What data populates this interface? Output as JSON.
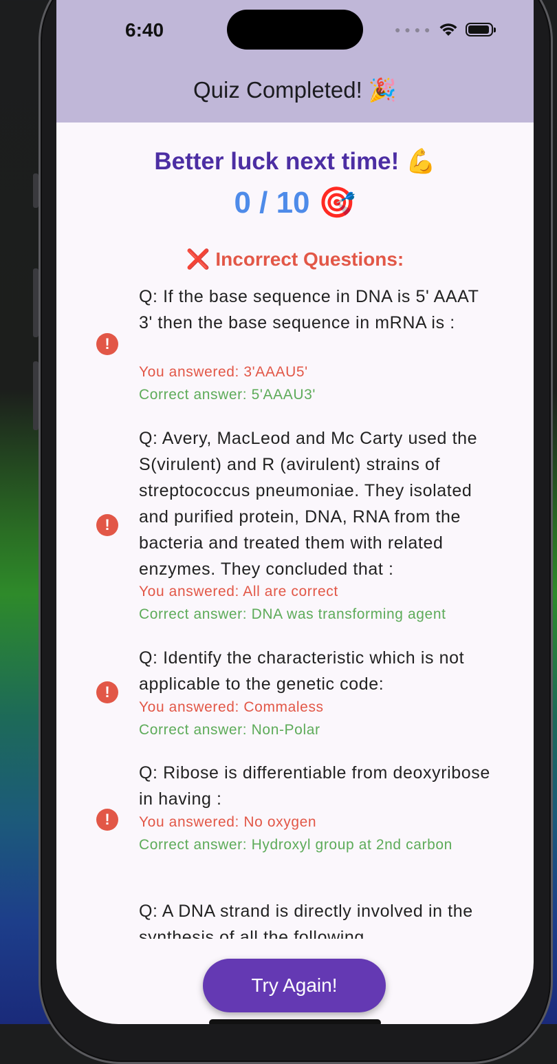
{
  "status_bar": {
    "time": "6:40",
    "cellular_icon": "cellular-dots-icon",
    "wifi_icon": "wifi-icon",
    "battery_icon": "battery-icon"
  },
  "app_bar": {
    "title": "Quiz Completed! 🎉"
  },
  "result": {
    "message": "Better luck next time! 💪",
    "score": "0 / 10 🎯"
  },
  "incorrect_section": {
    "icon": "❌",
    "header": "Incorrect Questions:"
  },
  "questions": [
    {
      "question": "Q: If the base sequence in DNA is 5' AAAT 3' then the base sequence in mRNA is :",
      "your_answer": "You answered: 3'AAAU5'",
      "correct_answer": "Correct answer: 5'AAAU3'",
      "icon": "alert-circle-icon"
    },
    {
      "question": "Q: Avery, MacLeod and Mc Carty used the S(virulent) and R (avirulent) strains of streptococcus pneumoniae. They isolated and purified protein, DNA, RNA from the bacteria and treated them with related enzymes. They concluded that :",
      "your_answer": "You answered: All are correct",
      "correct_answer": "Correct answer: DNA was transforming agent",
      "icon": "alert-circle-icon"
    },
    {
      "question": "Q: Identify the characteristic which is not applicable to the genetic code:",
      "your_answer": "You answered: Commaless",
      "correct_answer": "Correct answer: Non-Polar",
      "icon": "alert-circle-icon"
    },
    {
      "question": "Q: Ribose is differentiable from deoxyribose in having :",
      "your_answer": "You answered: No oxygen",
      "correct_answer": "Correct answer: Hydroxyl group at 2nd carbon",
      "icon": "alert-circle-icon"
    },
    {
      "question": "Q: A DNA strand is directly involved in the synthesis of all the following"
    }
  ],
  "actions": {
    "try_again_label": "Try Again!"
  },
  "colors": {
    "app_bar": "#c0b7d8",
    "title_purple": "#4c2ea3",
    "score_blue": "#4e8be9",
    "incorrect_red": "#e25747",
    "correct_green": "#5dab59",
    "button_purple": "#6439b3"
  }
}
